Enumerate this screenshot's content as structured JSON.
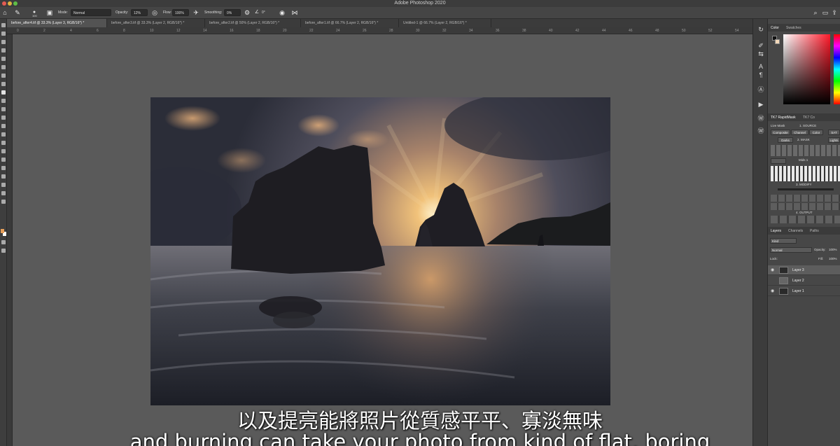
{
  "window": {
    "title": "Adobe Photoshop 2020"
  },
  "options_bar": {
    "brush_size": "100",
    "mode_label": "Mode:",
    "mode_value": "Normal",
    "opacity_label": "Opacity:",
    "opacity_value": "12%",
    "flow_label": "Flow:",
    "flow_value": "100%",
    "smoothing_label": "Smoothing:",
    "smoothing_value": "0%",
    "angle_value": "0°"
  },
  "tabs": [
    {
      "label": "before_after4.tif @ 33.3% (Layer 3, RGB/16*) *"
    },
    {
      "label": "before_after3.tif @ 33.3% (Layer 2, RGB/16*) *"
    },
    {
      "label": "before_after2.tif @ 50% (Layer 2, RGB/16*) *"
    },
    {
      "label": "before_after1.tif @ 66.7% (Layer 2, RGB/16*) *"
    },
    {
      "label": "Untitled-1 @ 66.7% (Layer 2, RGB/16*) *"
    }
  ],
  "ruler_ticks": [
    "0",
    "2",
    "4",
    "6",
    "8",
    "10",
    "12",
    "14",
    "16",
    "18",
    "20",
    "22",
    "24",
    "26",
    "28",
    "30",
    "32",
    "34",
    "36",
    "38",
    "40",
    "42",
    "44",
    "46",
    "48",
    "50",
    "52",
    "54"
  ],
  "color_panel": {
    "tabs": [
      "Color",
      "Swatches"
    ]
  },
  "tk_panel": {
    "tabs": [
      "TK7 RapidMask",
      "TK7 Co"
    ],
    "live_mask": "Live Mask",
    "source_title": "1. SOURCE",
    "source_buttons": [
      "Composite",
      "Channel",
      "Color",
      "SAT"
    ],
    "mask_title": "2. MASK",
    "mask_buttons": [
      "Darks",
      "Lights"
    ],
    "mid_label": "Mids 1",
    "modify_title": "3. MODIFY",
    "output_title": "4. OUTPUT"
  },
  "layers_panel": {
    "tabs": [
      "Layers",
      "Channels",
      "Paths"
    ],
    "kind_value": "Kind",
    "blend_value": "Normal",
    "opacity_label": "Opacity:",
    "opacity_value": "100%",
    "lock_label": "Lock:",
    "fill_label": "Fill:",
    "fill_value": "100%",
    "layers": [
      {
        "name": "Layer 3",
        "selected": true
      },
      {
        "name": "Layer 2",
        "selected": false
      },
      {
        "name": "Layer 1",
        "selected": false
      }
    ]
  },
  "subtitles": {
    "zh": "以及提亮能將照片從質感平平、寡淡無味",
    "en": "and burning can take your photo from kind of flat, boring"
  }
}
